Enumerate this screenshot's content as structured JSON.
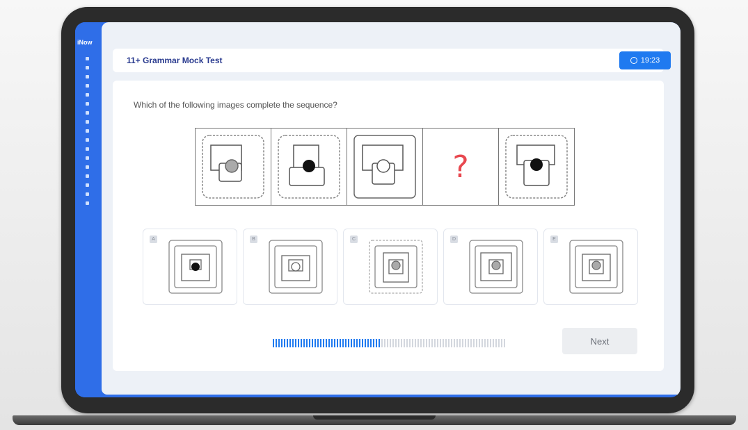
{
  "sidebar": {
    "brand": "iNow"
  },
  "header": {
    "title": "11+ Grammar Mock Test",
    "timer": "19:23",
    "timer_icon": "clock-icon"
  },
  "question": {
    "text": "Which of the following images complete the sequence?",
    "missing_marker": "?"
  },
  "sequence": [
    "gray-dot-frame-dotted",
    "black-dot-frame-dotted",
    "white-dot-frame-solid",
    "missing",
    "black-dot-frame-dotted"
  ],
  "options": [
    {
      "letter": "A",
      "dot": "black"
    },
    {
      "letter": "B",
      "dot": "white"
    },
    {
      "letter": "C",
      "dot": "gray"
    },
    {
      "letter": "D",
      "dot": "gray"
    },
    {
      "letter": "E",
      "dot": "gray"
    }
  ],
  "progress": {
    "completed_fraction": 0.46
  },
  "footer": {
    "next_label": "Next"
  },
  "colors": {
    "accent": "#1f7af0",
    "sidebar": "#2f6ee8",
    "question_mark": "#e8484f"
  }
}
